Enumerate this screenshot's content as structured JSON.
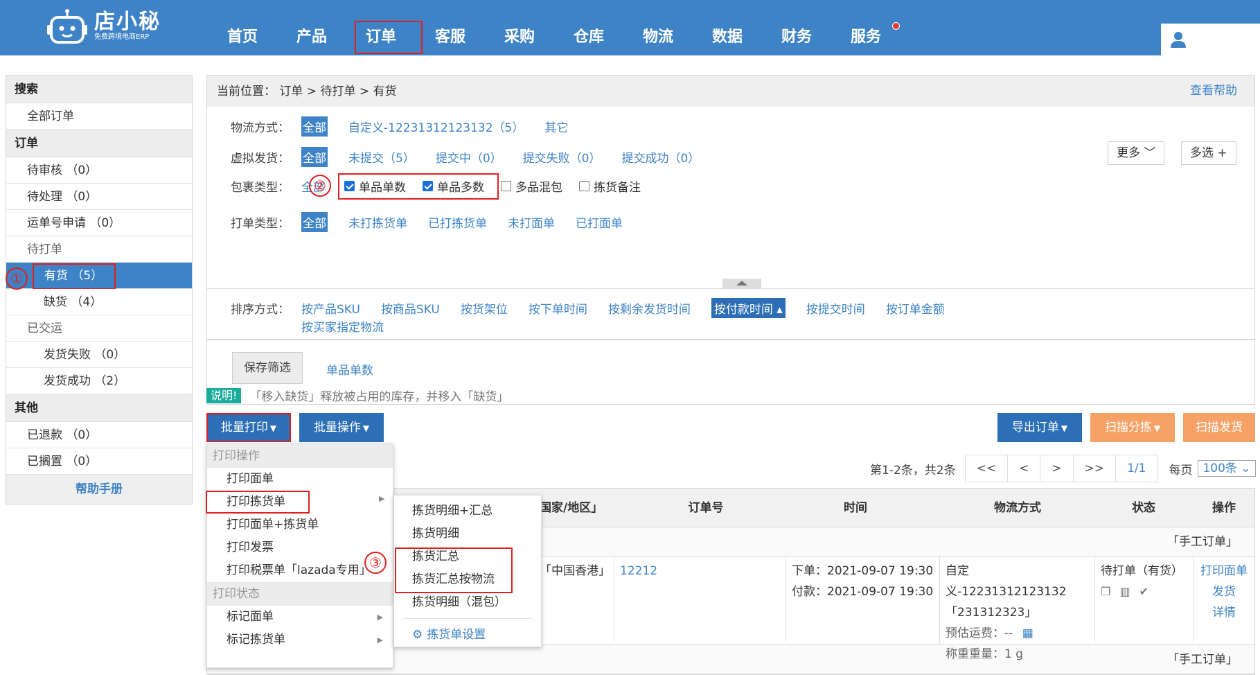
{
  "logo": {
    "name": "店小秘",
    "sub": "免费跨境电商ERP"
  },
  "nav": [
    "首页",
    "产品",
    "订单",
    "客服",
    "采购",
    "仓库",
    "物流",
    "数据",
    "财务",
    "服务"
  ],
  "sidebar": {
    "search_head": "搜索",
    "all_orders": "全部订单",
    "order_head": "订单",
    "pending_review": "待审核 （0）",
    "pending_process": "待处理 （0）",
    "tracking_apply": "运单号申请 （0）",
    "to_print": "待打单",
    "in_stock": "有货 （5）",
    "out_of_stock": "缺货 （4）",
    "shipped": "已交运",
    "ship_fail": "发货失败 （0）",
    "ship_ok": "发货成功 （2）",
    "other_head": "其他",
    "refunded": "已退款 （0）",
    "shelved": "已搁置 （0）",
    "help": "帮助手册"
  },
  "annotations": {
    "one": "①",
    "two": "②",
    "three": "③"
  },
  "crumb": {
    "text": "当前位置：  订单 > 待打单 > 有货",
    "help": "查看帮助"
  },
  "filters": {
    "logistics_label": "物流方式：",
    "logistics_all": "全部",
    "logistics_custom": "自定义-12231312123132（5）",
    "logistics_other": "其它",
    "more": "更多 ﹀",
    "multi": "多选 +",
    "virtual_label": "虚拟发货：",
    "virtual_all": "全部",
    "virtual_options": [
      "未提交（5）",
      "提交中（0）",
      "提交失败（0）",
      "提交成功（0）"
    ],
    "pkg_label": "包裹类型：",
    "pkg_all": "全部",
    "pkg_single_one": "单品单数",
    "pkg_single_multi": "单品多数",
    "pkg_mixed": "多品混包",
    "pkg_note": "拣货备注",
    "print_label": "打单类型：",
    "print_all": "全部",
    "print_options": [
      "未打拣货单",
      "已打拣货单",
      "未打面单",
      "已打面单"
    ],
    "sort_label": "排序方式：",
    "sort_options": [
      "按产品SKU",
      "按商品SKU",
      "按货架位",
      "按下单时间",
      "按剩余发货时间"
    ],
    "sort_selected": "按付款时间 ▴",
    "sort_options2": [
      "按提交时间",
      "按订单金额"
    ],
    "sort_buyer": "按买家指定物流",
    "save_btn": "保存筛选",
    "saved_name": "单品单数"
  },
  "note": {
    "badge": "说明!",
    "text": "「移入缺货」释放被占用的库存，并移入「缺货」"
  },
  "toolbar": {
    "batch_print": "批量打印",
    "batch_op": "批量操作",
    "export": "导出订单",
    "scan_sort": "扫描分拣",
    "scan_ship": "扫描发货"
  },
  "pager": {
    "info": "第1-2条，共2条",
    "first": "<<",
    "prev": "<",
    "next": ">",
    "last": ">>",
    "page": "1/1",
    "per_label": "每页",
    "per_value": "100条 ⌄"
  },
  "table": {
    "headers": [
      "国家/地区」",
      "订单号",
      "时间",
      "物流方式",
      "状态",
      "操作"
    ],
    "group_label": "「手工订单」",
    "row": {
      "country": "「中国香港」",
      "order_no": "12212",
      "order_time": "下单：2021-09-07 19:30",
      "pay_time": "付款：2021-09-07 19:30",
      "logistics": "自定义-12231312123132",
      "tracking": "「231312323」",
      "freight": "预估运费：--",
      "weight": "称重重量：1 g",
      "status": "待打单（有货）",
      "ops": [
        "打印面单",
        "发货",
        "详情"
      ]
    }
  },
  "menu1": {
    "sec_print": "打印操作",
    "items": [
      "打印面单",
      "打印拣货单",
      "打印面单+拣货单",
      "打印发票",
      "打印税票单「lazada专用」"
    ],
    "sec_status": "打印状态",
    "status_items": [
      "标记面单",
      "标记拣货单"
    ]
  },
  "menu2": {
    "items": [
      "拣货明细+汇总",
      "拣货明细",
      "拣货汇总",
      "拣货汇总按物流",
      "拣货明细（混包）"
    ],
    "settings": "拣货单设置"
  },
  "colors": {
    "brand": "#3d83c6",
    "highlight": "#e02020",
    "orange": "#f6a165",
    "note": "#1aab9b"
  }
}
